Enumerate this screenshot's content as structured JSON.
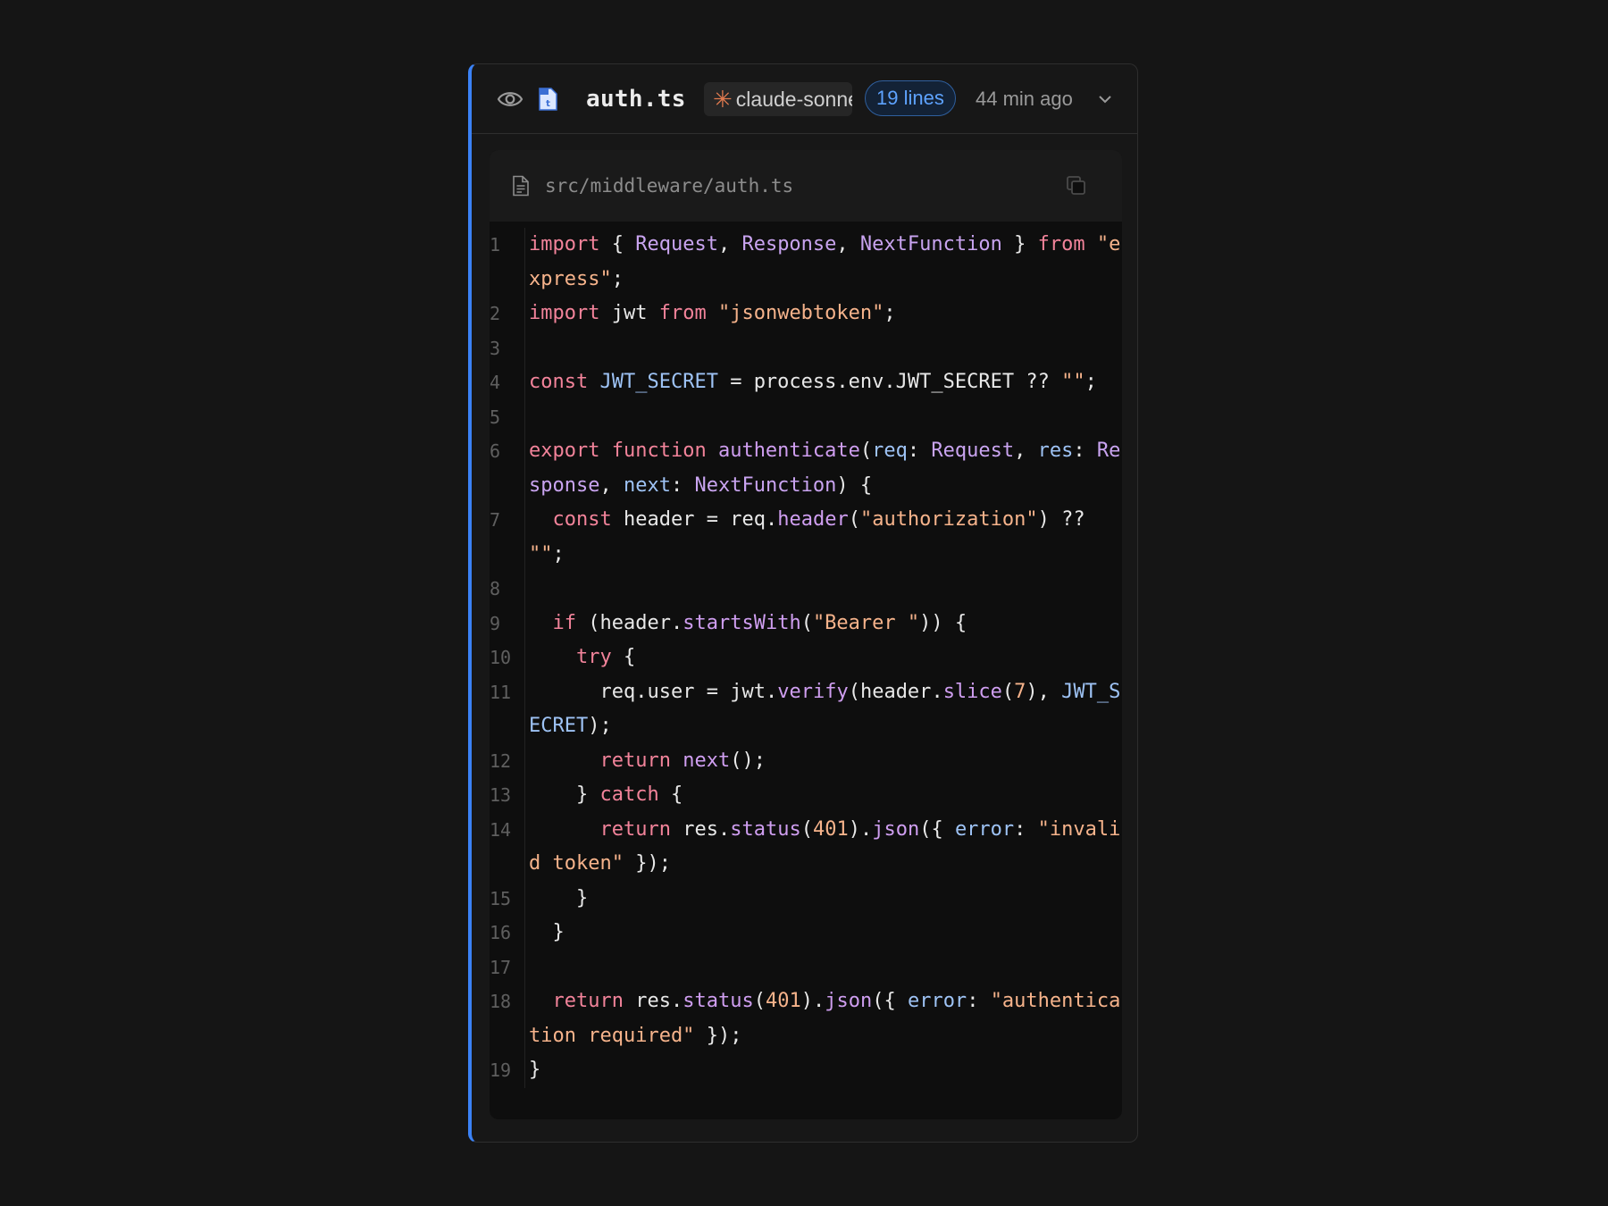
{
  "header": {
    "filename": "auth.ts",
    "model": "claude-sonnet",
    "lines_badge": "19 lines",
    "time": "44 min ago"
  },
  "file": {
    "path": "src/middleware/auth.ts"
  },
  "code": {
    "line_numbers": [
      "1",
      "2",
      "3",
      "4",
      "5",
      "6",
      "7",
      "8",
      "9",
      "10",
      "11",
      "12",
      "13",
      "14",
      "15",
      "16",
      "17",
      "18",
      "19"
    ],
    "lines": [
      "import { Request, Response, NextFunction } from \"express\";",
      "import jwt from \"jsonwebtoken\";",
      "",
      "const JWT_SECRET = process.env.JWT_SECRET ?? \"\";",
      "",
      "export function authenticate(req: Request, res: Response, next: NextFunction) {",
      "  const header = req.header(\"authorization\") ?? \"\";",
      "",
      "  if (header.startsWith(\"Bearer \")) {",
      "    try {",
      "      req.user = jwt.verify(header.slice(7), JWT_SECRET);",
      "      return next();",
      "    } catch {",
      "      return res.status(401).json({ error: \"invalid token\" });",
      "    }",
      "  }",
      "",
      "  return res.status(401).json({ error: \"authentication required\" });",
      "}"
    ]
  },
  "colors": {
    "accent_border": "#3b82f6",
    "keyword": "#f2839a",
    "string": "#f6b38b",
    "type": "#c9a4f0",
    "variable": "#9ec3f5"
  },
  "icons": [
    "eye-icon",
    "typescript-file-icon",
    "sparkle-icon",
    "chevron-down-icon",
    "document-icon",
    "copy-icon"
  ]
}
